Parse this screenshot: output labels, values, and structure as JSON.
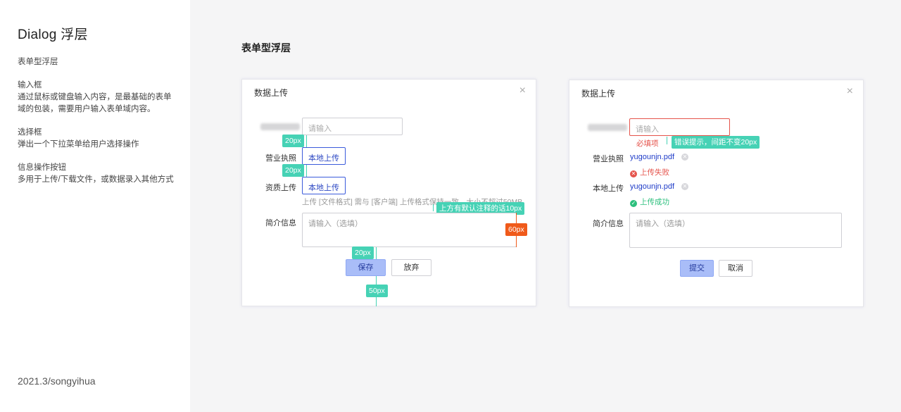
{
  "sidebar": {
    "title": "Dialog 浮层",
    "item1": "表单型浮层",
    "item2_title": "输入框",
    "item2_desc": "通过鼠标或键盘输入内容，是最基础的表单域的包装，需要用户输入表单域内容。",
    "item3_title": "选择框",
    "item3_desc": "弹出一个下拉菜单给用户选择操作",
    "item4_title": "信息操作按钮",
    "item4_desc": "多用于上传/下载文件，或数据录入其他方式",
    "footer": "2021.3/songyihua"
  },
  "section_title": "表单型浮层",
  "dialog1": {
    "title": "数据上传",
    "close_icon": "×",
    "input_placeholder": "请输入",
    "label_license": "营业执照",
    "upload_button": "本地上传",
    "label_qualification": "资质上传",
    "upload_button2": "本地上传",
    "upload_hint": "上传 [文件格式] 需与 [客户端] 上传格式保持一致，大小不超过50MB",
    "label_intro": "简介信息",
    "textarea_placeholder": "请输入（选填）",
    "save_button": "保存",
    "discard_button": "放弃",
    "annotations": {
      "gap1": "20px",
      "gap2": "20px",
      "hint_note": "上方有默认注释的话10px",
      "right_gap": "60px",
      "button_gap": "20px",
      "bottom_gap": "50px"
    }
  },
  "dialog2": {
    "title": "数据上传",
    "close_icon": "×",
    "input_placeholder": "请输入",
    "required_error": "必填项",
    "error_note": "错误提示，间距不变20px",
    "label_license": "营业执照",
    "file1": "yugounjn.pdf",
    "status_fail": "上传失败",
    "label_local": "本地上传",
    "file2": "yugounjn.pdf",
    "status_success": "上传成功",
    "label_intro": "简介信息",
    "textarea_placeholder": "请输入（选填）",
    "submit_button": "提交",
    "cancel_button": "取消"
  },
  "colors": {
    "annotation_green": "#46d2b5",
    "annotation_orange": "#f05a1a",
    "primary_blue": "#2e49c4",
    "error_red": "#e5534b",
    "success_green": "#2cbf7d"
  }
}
